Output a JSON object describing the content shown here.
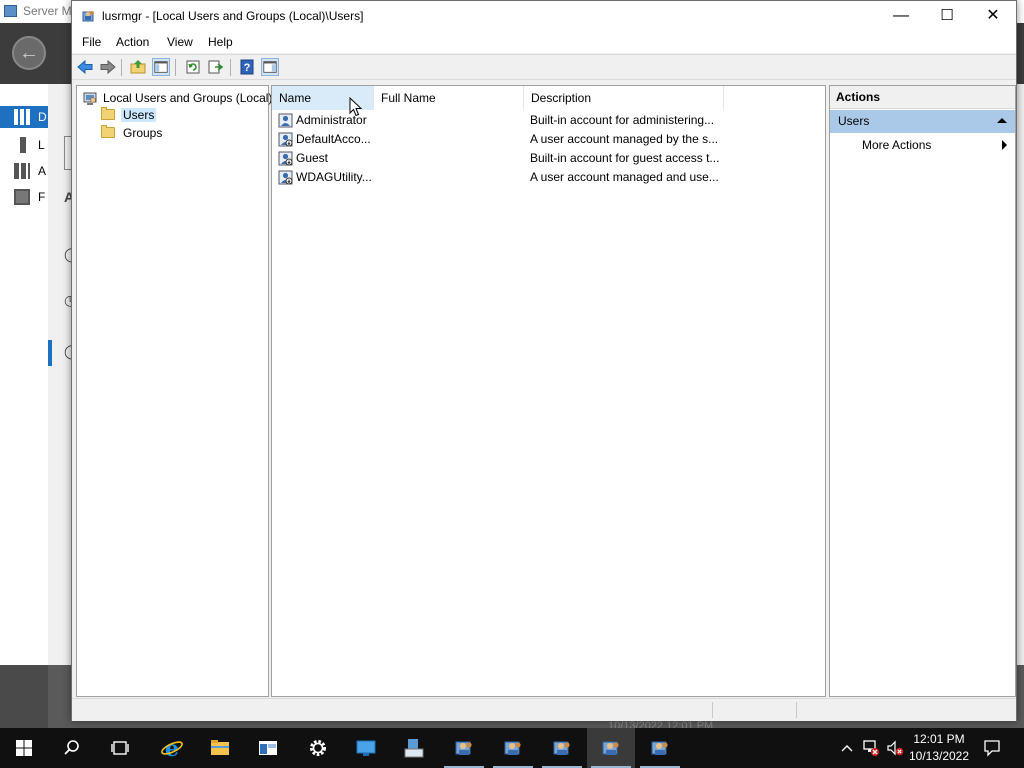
{
  "background_app": {
    "title": "Server M",
    "nav_letters": [
      "D",
      "L",
      "A",
      "F"
    ],
    "content_letter": "A",
    "status_text": "10/13/2022 12:01 PM"
  },
  "window": {
    "title": "lusrmgr - [Local Users and Groups (Local)\\Users]",
    "minimize_label": "—",
    "maximize_label": "☐",
    "close_label": "✕"
  },
  "menu": {
    "items": [
      "File",
      "Action",
      "View",
      "Help"
    ]
  },
  "toolbar": {
    "buttons": [
      "back-icon",
      "forward-icon",
      "up-folder-icon",
      "show-hide-tree-icon",
      "refresh-icon",
      "export-list-icon",
      "help-icon",
      "show-hide-action-pane-icon"
    ]
  },
  "tree": {
    "root": "Local Users and Groups (Local)",
    "children": [
      "Users",
      "Groups"
    ],
    "selected": "Users"
  },
  "list": {
    "columns": [
      "Name",
      "Full Name",
      "Description"
    ],
    "rows": [
      {
        "name": "Administrator",
        "full_name": "",
        "description": "Built-in account for administering..."
      },
      {
        "name": "DefaultAcco...",
        "full_name": "",
        "description": "A user account managed by the s..."
      },
      {
        "name": "Guest",
        "full_name": "",
        "description": "Built-in account for guest access t..."
      },
      {
        "name": "WDAGUtility...",
        "full_name": "",
        "description": "A user account managed and use..."
      }
    ]
  },
  "actions": {
    "header": "Actions",
    "section": "Users",
    "items": [
      "More Actions"
    ]
  },
  "taskbar": {
    "time": "12:01 PM",
    "date": "10/13/2022",
    "apps": [
      "start-icon",
      "search-icon",
      "task-view-icon",
      "internet-explorer-icon",
      "file-explorer-icon",
      "server-manager-icon",
      "settings-icon",
      "remote-desktop-icon",
      "network-folder-icon",
      "users-mmc-icon-1",
      "users-mmc-icon-2",
      "users-mmc-icon-3",
      "lusrmgr-icon",
      "users-mmc-icon-4"
    ]
  },
  "colors": {
    "accent": "#1e70c0",
    "selection": "#cce8ff",
    "actions_section": "#aac9e8",
    "taskbar": "#101010"
  }
}
